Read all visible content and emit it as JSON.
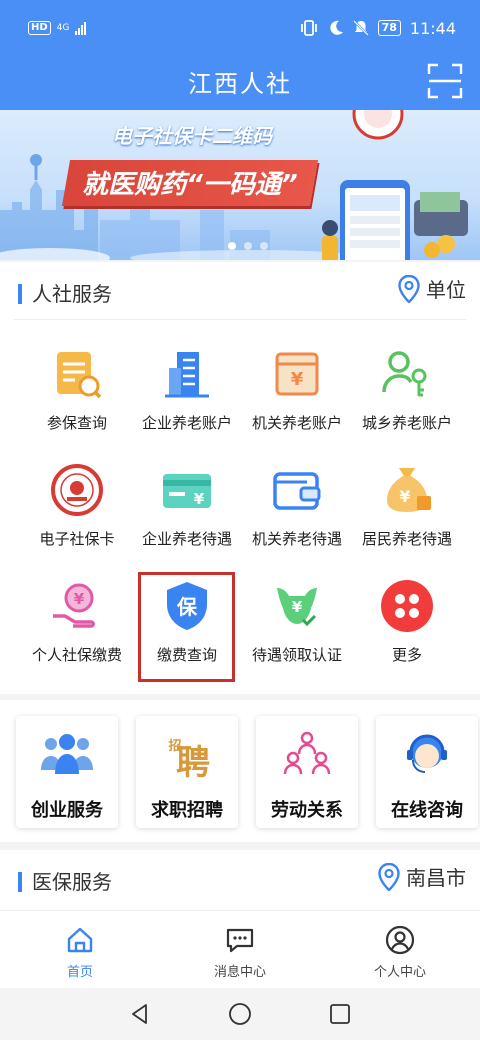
{
  "status_bar": {
    "hd": "HD",
    "network": "4G",
    "battery": "78",
    "time": "11:44"
  },
  "header": {
    "title": "江西人社",
    "scan_icon": "scan-icon"
  },
  "banner": {
    "subtitle": "电子社保卡二维码",
    "headline": "就医购药“一码通”"
  },
  "hr_services": {
    "title": "人社服务",
    "location_label": "单位",
    "items": [
      {
        "label": "参保查询",
        "icon": "document-search-icon"
      },
      {
        "label": "企业养老账户",
        "icon": "building-icon"
      },
      {
        "label": "机关养老账户",
        "icon": "yen-book-icon"
      },
      {
        "label": "城乡养老账户",
        "icon": "person-key-icon"
      },
      {
        "label": "电子社保卡",
        "icon": "social-security-seal-icon"
      },
      {
        "label": "企业养老待遇",
        "icon": "yen-card-icon"
      },
      {
        "label": "机关养老待遇",
        "icon": "wallet-icon"
      },
      {
        "label": "居民养老待遇",
        "icon": "money-bag-icon"
      },
      {
        "label": "个人社保缴费",
        "icon": "hand-coin-icon"
      },
      {
        "label": "缴费查询",
        "icon": "shield-bao-icon"
      },
      {
        "label": "待遇领取认证",
        "icon": "yen-verify-icon"
      },
      {
        "label": "更多",
        "icon": "more-grid-icon"
      }
    ]
  },
  "quick_services": [
    {
      "label": "创业服务",
      "icon": "team-icon"
    },
    {
      "label": "求职招聘",
      "icon": "recruit-icon"
    },
    {
      "label": "劳动关系",
      "icon": "people-network-icon"
    },
    {
      "label": "在线咨询",
      "icon": "customer-service-icon"
    }
  ],
  "medical_services": {
    "title": "医保服务",
    "location_label": "南昌市"
  },
  "bottom_nav": [
    {
      "label": "首页",
      "icon": "home-icon",
      "active": true
    },
    {
      "label": "消息中心",
      "icon": "message-icon",
      "active": false
    },
    {
      "label": "个人中心",
      "icon": "user-icon",
      "active": false
    }
  ],
  "colors": {
    "primary": "#4a8ff5",
    "accent_blue": "#3a84f2",
    "highlight_red": "#c9302c"
  }
}
